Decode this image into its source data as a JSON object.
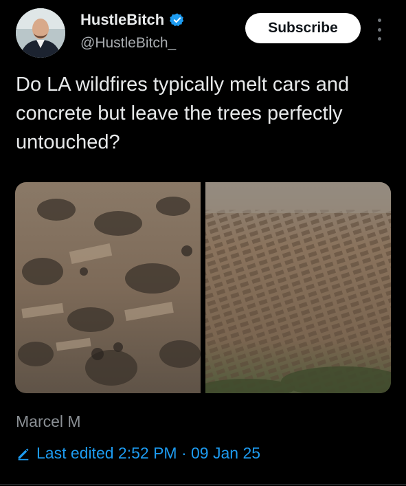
{
  "user": {
    "display_name": "HustleBitch",
    "handle": "@HustleBitch_",
    "verified": true
  },
  "actions": {
    "subscribe_label": "Subscribe",
    "more_icon": "more-vertical-icon"
  },
  "tweet": {
    "text": "Do LA wildfires typically melt cars and concrete but leave the trees perfectly untouched?"
  },
  "media": {
    "images": [
      {
        "name": "aerial-burned-neighborhood-left"
      },
      {
        "name": "aerial-burned-neighborhood-right"
      }
    ]
  },
  "footer": {
    "author": "Marcel M",
    "edited_label": "Last edited 2:52 PM · 09 Jan 25"
  },
  "colors": {
    "background": "#000000",
    "text": "#e7e9ea",
    "secondary": "#8b9095",
    "accent": "#1d9bf0"
  }
}
